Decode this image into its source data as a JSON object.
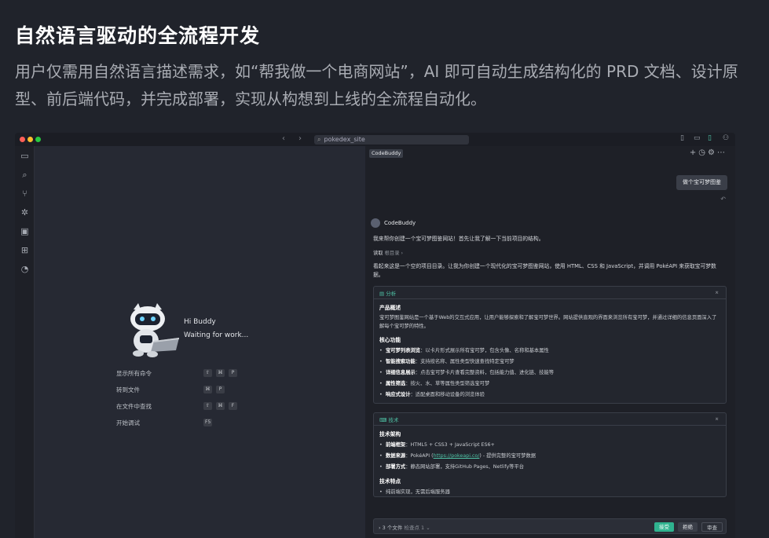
{
  "hero": {
    "title": "自然语言驱动的全流程开发",
    "subtitle": "用户仅需用自然语言描述需求，如“帮我做一个电商网站”，AI 即可自动生成结构化的 PRD 文档、设计原型、前后端代码，并完成部署，实现从构想到上线的全流程自动化。"
  },
  "titlebar": {
    "search_value": "pokedex_site",
    "nav_back": "‹",
    "nav_forward": "›"
  },
  "activity_icons": [
    "files-icon",
    "search-icon",
    "source-control-icon",
    "debug-icon",
    "remote-icon",
    "extensions-icon",
    "codebuddy-icon"
  ],
  "welcome": {
    "greeting": "Hi Buddy",
    "status": "Waiting for work...",
    "commands": [
      {
        "label": "显示所有命令",
        "keys": [
          "⇧",
          "⌘",
          "P"
        ]
      },
      {
        "label": "转到文件",
        "keys": [
          "⌘",
          "P"
        ]
      },
      {
        "label": "在文件中查找",
        "keys": [
          "⇧",
          "⌘",
          "F"
        ]
      },
      {
        "label": "开始调试",
        "keys": [
          "F5"
        ]
      }
    ]
  },
  "panel": {
    "tab": "CodeBuddy",
    "user_message": "做个宝可梦图鉴",
    "bot_name": "CodeBuddy",
    "intro": "我来帮你创建一个宝可梦图鉴网站！首先让我了解一下当前项目的结构。",
    "read_label": "读取",
    "read_target": "根目录",
    "plan": "看起来这是一个空的项目目录。让我为你创建一个现代化的宝可梦图鉴网站，使用 HTML、CSS 和 JavaScript，并调用 PokéAPI 来获取宝可梦数据。",
    "analysis_card": {
      "label": "分析",
      "overview_title": "产品概述",
      "overview_text": "宝可梦图鉴网站是一个基于Web的交互式应用，让用户能够探索和了解宝可梦世界。网站提供直观的界面来浏览所有宝可梦，并通过详细的信息页面深入了解每个宝可梦的特性。",
      "features_title": "核心功能",
      "features": [
        {
          "name": "宝可梦列表浏览",
          "desc": "以卡片形式展示所有宝可梦，包含头像、名称和基本属性"
        },
        {
          "name": "智能搜索功能",
          "desc": "支持按名称、属性类型快速查找特定宝可梦"
        },
        {
          "name": "详细信息展示",
          "desc": "点击宝可梦卡片查看完整资料，包括能力值、进化链、技能等"
        },
        {
          "name": "属性筛选",
          "desc": "按火、水、草等属性类型筛选宝可梦"
        },
        {
          "name": "响应式设计",
          "desc": "适配桌面和移动设备的浏览体验"
        }
      ]
    },
    "tech_card": {
      "label": "技术",
      "arch_title": "技术架构",
      "arch_items": [
        {
          "name": "前端框架",
          "desc": "HTML5 + CSS3 + JavaScript ES6+"
        },
        {
          "name": "数据来源",
          "desc_pre": "PokéAPI (",
          "link": "https://pokeapi.co/",
          "desc_post": ") - 提供完整的宝可梦数据"
        },
        {
          "name": "部署方式",
          "desc": "静态网站部署，支持GitHub Pages、Netlify等平台"
        }
      ],
      "traits_title": "技术特点",
      "traits": [
        "纯前端实现，无需后端服务器"
      ]
    },
    "footer": {
      "files": "3 个文件",
      "checkpoint": "检查点 1",
      "accept": "接受",
      "reject": "拒绝",
      "review": "审查"
    },
    "colors": {
      "accent": "#4fc3a6"
    }
  }
}
